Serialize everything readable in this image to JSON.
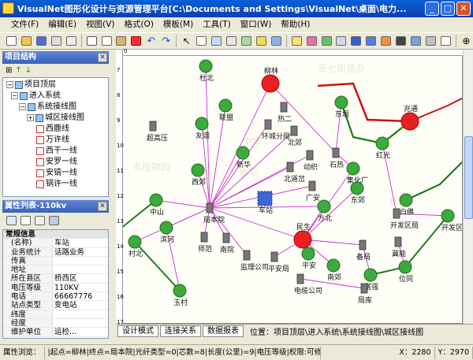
{
  "window": {
    "title": "VisualNet图形化设计与资源管理平台[C:\\Documents and Settings\\VisualNet\\桌面\\电力..."
  },
  "menu": [
    "文件(F)",
    "编辑(E)",
    "视图(V)",
    "格式(O)",
    "模板(M)",
    "工具(T)",
    "窗口(W)",
    "帮助(H)"
  ],
  "tree_panel": {
    "title": "项目结构",
    "nodes": [
      "项目顶层",
      "进入系统",
      "系统接线图",
      "城区接线图",
      "西鹿线",
      "万许线",
      "西干一线",
      "安罗一线",
      "安镐一线",
      "锅许一线"
    ]
  },
  "prop_panel": {
    "title": "属性列表-110kv",
    "group": "常规信息",
    "rows": [
      {
        "k": "(名称)",
        "v": "车站"
      },
      {
        "k": "业务统计",
        "v": "话路业务"
      },
      {
        "k": "传真",
        "v": ""
      },
      {
        "k": "地址",
        "v": ""
      },
      {
        "k": "所在县区",
        "v": "桥西区"
      },
      {
        "k": "电压等级",
        "v": "110KV"
      },
      {
        "k": "电话",
        "v": "66667776"
      },
      {
        "k": "站点类型",
        "v": "变电站"
      },
      {
        "k": "纬度",
        "v": ""
      },
      {
        "k": "经度",
        "v": ""
      },
      {
        "k": "维护单位",
        "v": "运检..."
      }
    ]
  },
  "tabs": [
    "设计模式",
    "连接关系",
    "数据报表"
  ],
  "location": "位置：项目顶层\\进入系统\\系统接线图\\城区接线图",
  "status": {
    "hint": "属性浏览：",
    "info": "|起点=柳林|终点=局本院|光纤类型=0|芯数=8|长度(公里)=9|电压等级|权限:可修改",
    "x": "X：2280",
    "y": "Y：2970"
  },
  "ruler_top": [
    "0",
    "",
    "",
    "",
    "",
    "",
    "",
    "",
    "",
    "",
    ""
  ],
  "ruler_left": [
    "7",
    "8",
    "9",
    "10",
    "11",
    "12",
    "13",
    "14",
    "15",
    "16",
    "17"
  ],
  "map": {
    "bg_labels": [
      "五七街道办",
      "中学",
      "市植物园",
      "新华",
      "长安"
    ],
    "node_labels": [
      "杜北",
      "柳林",
      "联盟",
      "热二",
      "东垣",
      "兆通",
      "超高压",
      "友谊",
      "环城分局",
      "北郊",
      "石热",
      "红光",
      "西郊",
      "新华",
      "动织",
      "集化厂",
      "北道岔",
      "广安",
      "东郊",
      "中山",
      "局本院",
      "车站",
      "方北",
      "开发区局",
      "白佛",
      "滨河",
      "民生",
      "开发区电厂",
      "冀能",
      "师范",
      "南院",
      "监理公司",
      "平安局",
      "备局",
      "南郊",
      "富强",
      "位同",
      "村北",
      "电缆公司",
      "局库",
      "玉村",
      "平安"
    ]
  },
  "colors": {
    "titlebar": "#0c4ccc",
    "red_node": "#e82020",
    "green_node": "#3caa3c",
    "link": "#cc33cc"
  }
}
